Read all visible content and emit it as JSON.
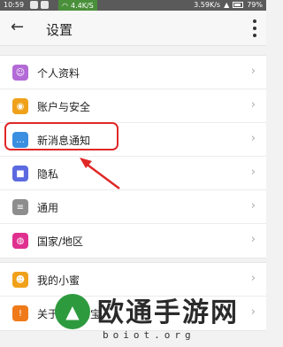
{
  "status_bar": {
    "time": "10:59",
    "network_speed": "4.4K/S",
    "speed_right": "3.59K/s",
    "battery": "79%"
  },
  "header": {
    "title": "设置"
  },
  "group1": [
    {
      "label": "个人资料",
      "icon": "person-icon",
      "color": "#b36ad6"
    },
    {
      "label": "账户与安全",
      "icon": "shield-icon",
      "color": "#f0a11a"
    },
    {
      "label": "新消息通知",
      "icon": "chat-bubble-icon",
      "color": "#3a8fe0"
    },
    {
      "label": "隐私",
      "icon": "lock-icon",
      "color": "#5b6ae0"
    },
    {
      "label": "通用",
      "icon": "document-icon",
      "color": "#8d8d8d"
    },
    {
      "label": "国家/地区",
      "icon": "globe-icon",
      "color": "#e0308f"
    }
  ],
  "group2": [
    {
      "label": "我的小蜜",
      "icon": "assistant-icon",
      "color": "#f0a11a"
    },
    {
      "label": "关于手机淘宝",
      "icon": "info-icon",
      "color": "#f07a1a"
    }
  ],
  "watermark": {
    "main_text": "欧通手游网",
    "sub_text": "boiot.org"
  }
}
